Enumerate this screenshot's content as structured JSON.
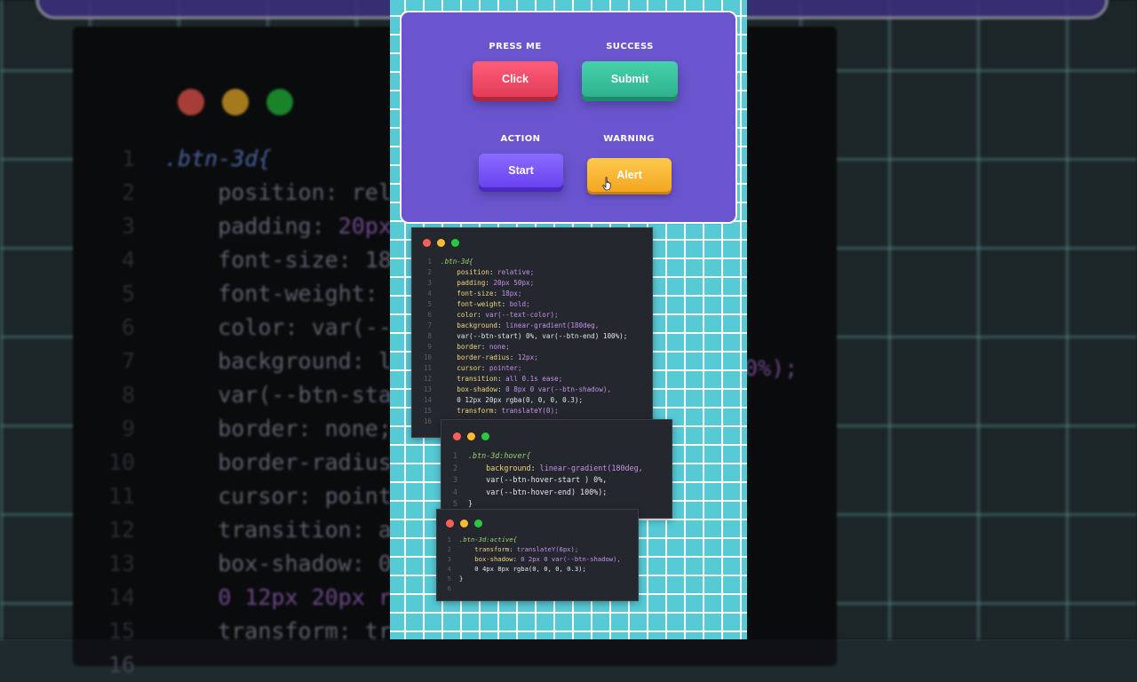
{
  "colors": {
    "red": "#ff5f57",
    "yellow": "#febc2e",
    "green": "#28c840",
    "card": "#6a55cf",
    "grid_bg": "#56cbd6"
  },
  "demo": {
    "buttons": [
      {
        "caption": "PRESS ME",
        "label": "Click"
      },
      {
        "caption": "SUCCESS",
        "label": "Submit"
      },
      {
        "caption": "ACTION",
        "label": "Start"
      },
      {
        "caption": "WARNING",
        "label": "Alert"
      }
    ]
  },
  "background_editor": {
    "lines": [
      {
        "n": "1",
        "code": ".btn-3d{"
      },
      {
        "n": "2",
        "code": "    position: rel"
      },
      {
        "n": "3",
        "code": "    padding: 20px"
      },
      {
        "n": "4",
        "code": "    font-size: 18"
      },
      {
        "n": "5",
        "code": "    font-weight:"
      },
      {
        "n": "6",
        "code": "    color: var(--"
      },
      {
        "n": "7",
        "code": "    background: l"
      },
      {
        "n": "8",
        "code": "    var(--btn-sta"
      },
      {
        "n": "9",
        "code": "    border: none;"
      },
      {
        "n": "10",
        "code": "    border-radius"
      },
      {
        "n": "11",
        "code": "    cursor: point"
      },
      {
        "n": "12",
        "code": "    transition: a"
      },
      {
        "n": "13",
        "code": "    box-shadow: 0"
      },
      {
        "n": "14",
        "code": "    0 12px 20px r"
      },
      {
        "n": "15",
        "code": "    transform: tr"
      },
      {
        "n": "16",
        "code": ""
      }
    ],
    "fragment": "0%);"
  },
  "code_windows": {
    "base": [
      {
        "n": "1",
        "code": ".btn-3d{"
      },
      {
        "n": "2",
        "code": "    position: relative;"
      },
      {
        "n": "3",
        "code": "    padding: 20px 50px;"
      },
      {
        "n": "4",
        "code": "    font-size: 18px;"
      },
      {
        "n": "5",
        "code": "    font-weight: bold;"
      },
      {
        "n": "6",
        "code": "    color: var(--text-color);"
      },
      {
        "n": "7",
        "code": "    background: linear-gradient(180deg,"
      },
      {
        "n": "8",
        "code": "    var(--btn-start) 0%, var(--btn-end) 100%);"
      },
      {
        "n": "9",
        "code": "    border: none;"
      },
      {
        "n": "10",
        "code": "    border-radius: 12px;"
      },
      {
        "n": "11",
        "code": "    cursor: pointer;"
      },
      {
        "n": "12",
        "code": "    transition: all 0.1s ease;"
      },
      {
        "n": "13",
        "code": "    box-shadow: 0 8px 0 var(--btn-shadow),"
      },
      {
        "n": "14",
        "code": "    0 12px 20px rgba(0, 0, 0, 0.3);"
      },
      {
        "n": "15",
        "code": "    transform: translateY(0);"
      },
      {
        "n": "16",
        "code": ""
      }
    ],
    "hover": [
      {
        "n": "1",
        "code": ".btn-3d:hover{"
      },
      {
        "n": "2",
        "code": "    background: linear-gradient(180deg,"
      },
      {
        "n": "3",
        "code": "    var(--btn-hover-start ) 0%,"
      },
      {
        "n": "4",
        "code": "    var(--btn-hover-end) 100%);"
      },
      {
        "n": "5",
        "code": "}"
      }
    ],
    "active": [
      {
        "n": "1",
        "code": ".btn-3d:active{"
      },
      {
        "n": "2",
        "code": "    transform: translateY(6px);"
      },
      {
        "n": "3",
        "code": "    box-shadow: 0 2px 0 var(--btn-shadow),"
      },
      {
        "n": "4",
        "code": "    0 4px 8px rgba(0, 0, 0, 0.3);"
      },
      {
        "n": "5",
        "code": "}"
      },
      {
        "n": "6",
        "code": ""
      }
    ]
  }
}
